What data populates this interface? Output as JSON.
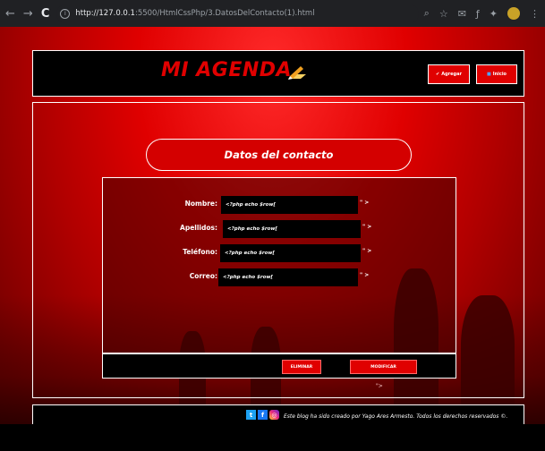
{
  "browser": {
    "url_host": "http://127.0.0.1",
    "url_path": ":5500/HtmlCssPhp/3.DatosDelContacto(1).html"
  },
  "header": {
    "logo": "MI AGENDA",
    "add_button": "Agregar",
    "home_button": "Inicio"
  },
  "main": {
    "title": "Datos del contacto",
    "fields": [
      {
        "label": "Nombre:",
        "value": "<?php echo $row[",
        "tail": "\" >"
      },
      {
        "label": "Apellidos:",
        "value": "<?php echo $row[",
        "tail": "\" >"
      },
      {
        "label": "Teléfono:",
        "value": "<?php echo $row[",
        "tail": "\" >"
      },
      {
        "label": "Correo:",
        "value": "<?php echo $row[",
        "tail": "\" >"
      }
    ],
    "delete_button": "ELIMINAR",
    "modify_button": "MODIFICAR",
    "small_mark": "\">"
  },
  "footer": {
    "text": "Este blog ha sido creado por Yago Ares Armesto. Todos los derechos reservados ©."
  },
  "colors": {
    "accent": "#e00000",
    "panel": "#000000"
  }
}
